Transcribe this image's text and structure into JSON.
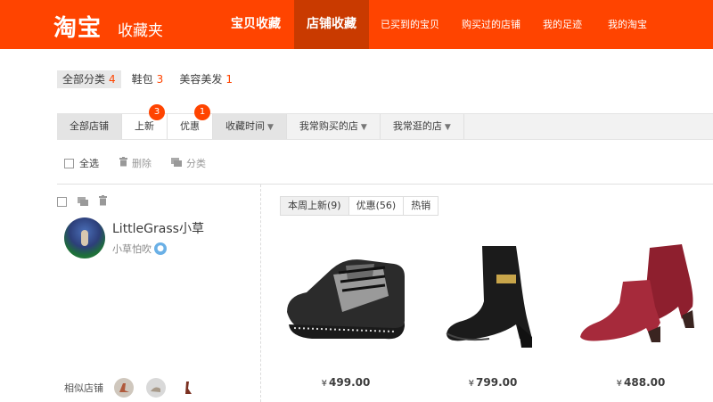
{
  "header": {
    "logo": "淘宝",
    "logo_sub": "收藏夹",
    "nav": [
      {
        "label": "宝贝收藏",
        "size": "big",
        "active": false
      },
      {
        "label": "店铺收藏",
        "size": "big",
        "active": true
      },
      {
        "label": "已买到的宝贝",
        "size": "small",
        "active": false
      },
      {
        "label": "购买过的店铺",
        "size": "small",
        "active": false
      },
      {
        "label": "我的足迹",
        "size": "small",
        "active": false
      },
      {
        "label": "我的淘宝",
        "size": "small",
        "active": false
      }
    ]
  },
  "categories": [
    {
      "label": "全部分类",
      "count": "4",
      "selected": true
    },
    {
      "label": "鞋包",
      "count": "3",
      "selected": false
    },
    {
      "label": "美容美发",
      "count": "1",
      "selected": false
    }
  ],
  "tabs": [
    {
      "label": "全部店铺",
      "badge": "",
      "arrow": false,
      "style": "grey"
    },
    {
      "label": "上新",
      "badge": "3",
      "arrow": false,
      "style": "white"
    },
    {
      "label": "优惠",
      "badge": "1",
      "arrow": false,
      "style": "white"
    },
    {
      "label": "收藏时间",
      "badge": "",
      "arrow": true,
      "style": "grey"
    },
    {
      "label": "我常购买的店",
      "badge": "",
      "arrow": true,
      "style": "plain"
    },
    {
      "label": "我常逛的店",
      "badge": "",
      "arrow": true,
      "style": "plain"
    }
  ],
  "toolbar": {
    "select_all": "全选",
    "delete": "删除",
    "classify": "分类"
  },
  "store": {
    "name": "LittleGrass小草",
    "subtitle": "小草怕吹",
    "similar_label": "相似店铺"
  },
  "product_tabs": [
    {
      "label": "本周上新(9)",
      "selected": true
    },
    {
      "label": "优惠(56)",
      "selected": false
    },
    {
      "label": "热销",
      "selected": false
    }
  ],
  "products": [
    {
      "name": "sneaker",
      "price": "499.00",
      "currency": "¥"
    },
    {
      "name": "black-boot",
      "price": "799.00",
      "currency": "¥"
    },
    {
      "name": "red-boot",
      "price": "488.00",
      "currency": "¥"
    }
  ],
  "colors": {
    "brand": "#ff4400",
    "brand_active": "#c93a00",
    "badge": "#ff4400"
  }
}
